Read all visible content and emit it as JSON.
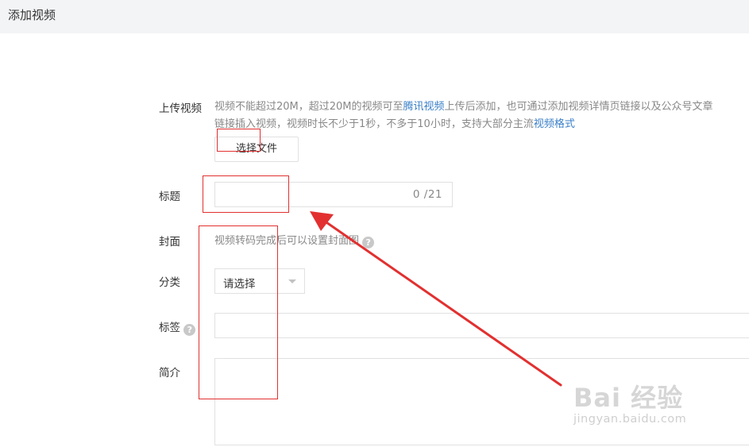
{
  "header": {
    "title": "添加视频"
  },
  "upload": {
    "label": "上传视频",
    "desc_line1_a": "视频不能超过20M，超过20M的视频可至",
    "desc_link1": "腾讯视频",
    "desc_line1_b": "上传后添加，也可通过添加视频详情页链接以及公众号文章",
    "desc_line2_a": "链接插入视频，视频时长不少于1秒，不多于10小时，支持大部分主流",
    "desc_link2": "视频格式",
    "button_label": "选择文件"
  },
  "title_field": {
    "label": "标题",
    "value": "",
    "counter": "0 /21"
  },
  "cover": {
    "label": "封面",
    "hint": "视频转码完成后可以设置封面图",
    "help_icon": "question-circle-icon"
  },
  "category": {
    "label": "分类",
    "selected": "请选择"
  },
  "tags": {
    "label": "标签",
    "help_icon": "question-circle-icon",
    "value": ""
  },
  "intro": {
    "label": "简介",
    "value": ""
  },
  "annotation_color": "#e23030",
  "watermark": {
    "main": "Bai 经验",
    "sub": "jingyan.baidu.com"
  }
}
